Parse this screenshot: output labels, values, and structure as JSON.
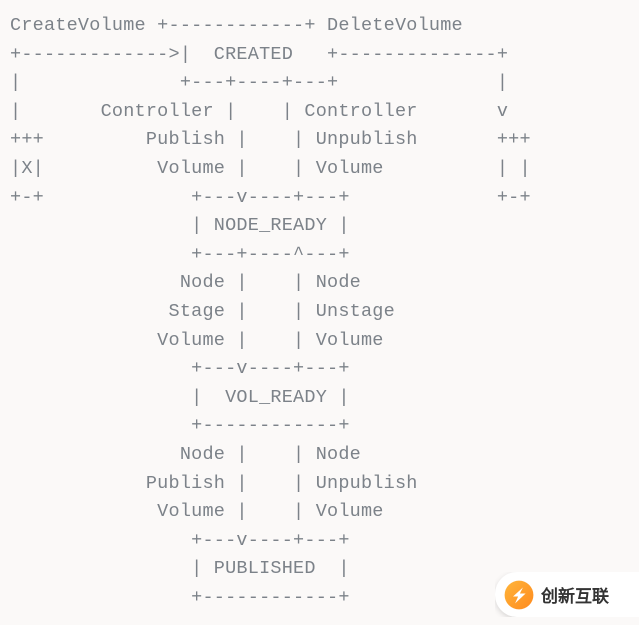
{
  "diagram_lines": [
    "CreateVolume +------------+ DeleteVolume",
    "+------------->|  CREATED   +--------------+",
    "|              +---+----+---+              |",
    "|       Controller |    | Controller       v",
    "+++         Publish |    | Unpublish       +++",
    "|X|          Volume |    | Volume          | |",
    "+-+             +---v----+---+             +-+",
    "                | NODE_READY |",
    "                +---+----^---+",
    "               Node |    | Node",
    "              Stage |    | Unstage",
    "             Volume |    | Volume",
    "                +---v----+---+",
    "                |  VOL_READY |",
    "                +------------+",
    "               Node |    | Node",
    "            Publish |    | Unpublish",
    "             Volume |    | Volume",
    "                +---v----+---+",
    "                | PUBLISHED  |",
    "                +------------+"
  ],
  "logo": {
    "text": "创新互联",
    "mark_name": "chuangxin-logo-icon"
  }
}
